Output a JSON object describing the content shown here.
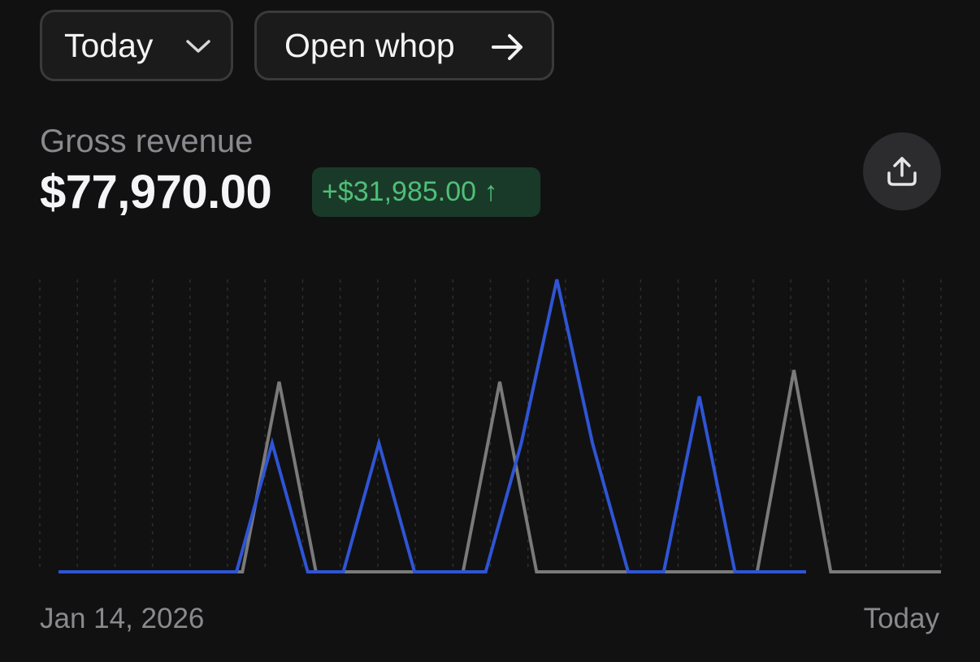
{
  "controls": {
    "range_label": "Today",
    "open_label": "Open whop"
  },
  "metric": {
    "label": "Gross revenue",
    "value": "$77,970.00",
    "delta": "+$31,985.00 ↑"
  },
  "icons": {
    "range": "chevron-down-icon",
    "open": "arrow-right-icon",
    "share": "share-icon"
  },
  "colors": {
    "current_series": "#2f55d4",
    "previous_series": "#7a7a7a",
    "delta_text": "#4fbf78",
    "delta_bg": "#1a3a29"
  },
  "chart_data": {
    "type": "line",
    "x_start_label": "Jan 14, 2026",
    "x_end_label": "Today",
    "grid": "vertical-dashed",
    "x_count": 24,
    "ylim": [
      0,
      1
    ],
    "series": [
      {
        "role": "previous",
        "color": "#7a7a7a",
        "values": [
          0,
          0,
          0,
          0,
          0,
          0,
          0.65,
          0,
          0,
          0,
          0,
          0,
          0.65,
          0,
          0,
          0,
          0,
          0,
          0,
          0,
          0.69,
          0,
          0,
          0,
          0
        ]
      },
      {
        "role": "current",
        "color": "#2f55d4",
        "values": [
          0,
          0,
          0,
          0,
          0,
          0,
          0.44,
          0,
          0,
          0.44,
          0,
          0,
          0,
          0.44,
          1.0,
          0.44,
          0,
          0,
          0.6,
          0,
          0,
          0
        ]
      }
    ]
  }
}
